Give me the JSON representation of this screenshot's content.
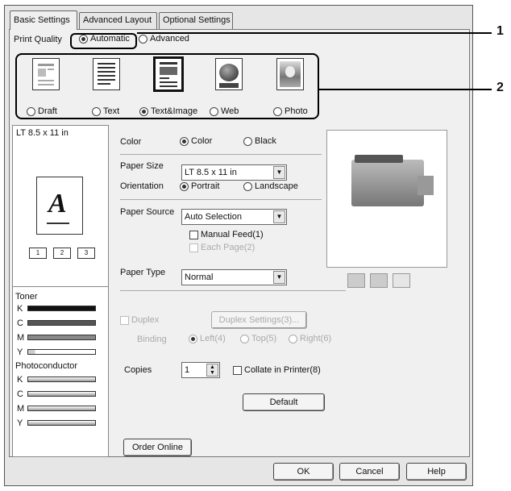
{
  "tabs": [
    "Basic Settings",
    "Advanced Layout",
    "Optional Settings"
  ],
  "print_quality": {
    "label": "Print Quality",
    "automatic": "Automatic",
    "advanced": "Advanced",
    "options": [
      "Draft",
      "Text",
      "Text&Image",
      "Web",
      "Photo"
    ],
    "selected": "Text&Image"
  },
  "paper_preview": {
    "size_label": "LT 8.5 x 11 in",
    "letter": "A"
  },
  "color": {
    "label": "Color",
    "options": [
      "Color",
      "Black"
    ],
    "selected": "Color"
  },
  "paper_size": {
    "label": "Paper Size",
    "value": "LT 8.5 x 11 in"
  },
  "orientation": {
    "label": "Orientation",
    "options": [
      "Portrait",
      "Landscape"
    ],
    "selected": "Portrait"
  },
  "paper_source": {
    "label": "Paper Source",
    "value": "Auto Selection",
    "manual_feed": "Manual Feed(1)",
    "each_page": "Each Page(2)"
  },
  "paper_type": {
    "label": "Paper Type",
    "value": "Normal"
  },
  "duplex": {
    "label": "Duplex",
    "settings_button": "Duplex Settings(3)...",
    "binding_label": "Binding",
    "binding_options": [
      "Left(4)",
      "Top(5)",
      "Right(6)"
    ]
  },
  "copies": {
    "label": "Copies",
    "value": "1",
    "collate": "Collate in Printer(8)"
  },
  "default_button": "Default",
  "order_online_button": "Order Online",
  "consumables": {
    "toner_label": "Toner",
    "toner": [
      {
        "name": "K",
        "level": 1.0
      },
      {
        "name": "C",
        "level": 1.0
      },
      {
        "name": "M",
        "level": 1.0
      },
      {
        "name": "Y",
        "level": 0.1
      }
    ],
    "photo_label": "Photoconductor",
    "photo": [
      {
        "name": "K"
      },
      {
        "name": "C"
      },
      {
        "name": "M"
      },
      {
        "name": "Y"
      }
    ]
  },
  "footer": {
    "ok": "OK",
    "cancel": "Cancel",
    "help": "Help"
  },
  "callouts": [
    "1",
    "2"
  ]
}
